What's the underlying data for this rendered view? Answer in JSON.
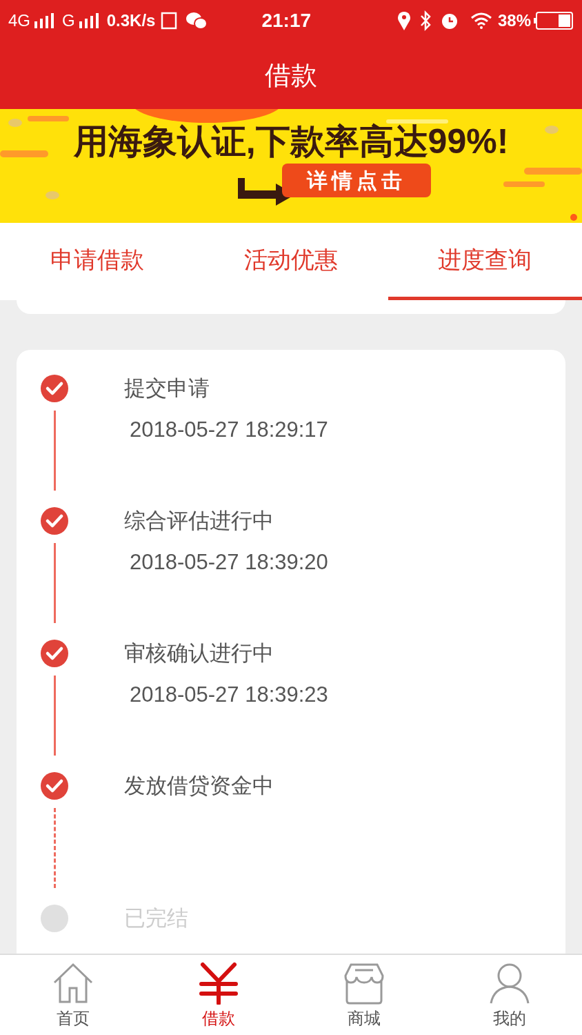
{
  "status_bar": {
    "network_1": "4G",
    "network_2": "G",
    "speed": "0.3K/s",
    "time": "21:17",
    "battery": "38%"
  },
  "header": {
    "title": "借款"
  },
  "banner": {
    "headline": "用海象认证,下款率高达99%!",
    "button": "详情点击"
  },
  "tabs": [
    {
      "label": "申请借款",
      "selected": false
    },
    {
      "label": "活动优惠",
      "selected": false
    },
    {
      "label": "进度查询",
      "selected": true
    }
  ],
  "steps": [
    {
      "title": "提交申请",
      "time": "2018-05-27 18:29:17",
      "done": true
    },
    {
      "title": "综合评估进行中",
      "time": "2018-05-27 18:39:20",
      "done": true
    },
    {
      "title": "审核确认进行中",
      "time": "2018-05-27 18:39:23",
      "done": true
    },
    {
      "title": "发放借贷资金中",
      "done": true
    },
    {
      "title": "已完结",
      "done": false
    }
  ],
  "nav": [
    {
      "label": "首页",
      "kind": "home",
      "selected": false
    },
    {
      "label": "借款",
      "kind": "yen",
      "selected": true
    },
    {
      "label": "商城",
      "kind": "shop",
      "selected": false
    },
    {
      "label": "我的",
      "kind": "user",
      "selected": false
    }
  ]
}
